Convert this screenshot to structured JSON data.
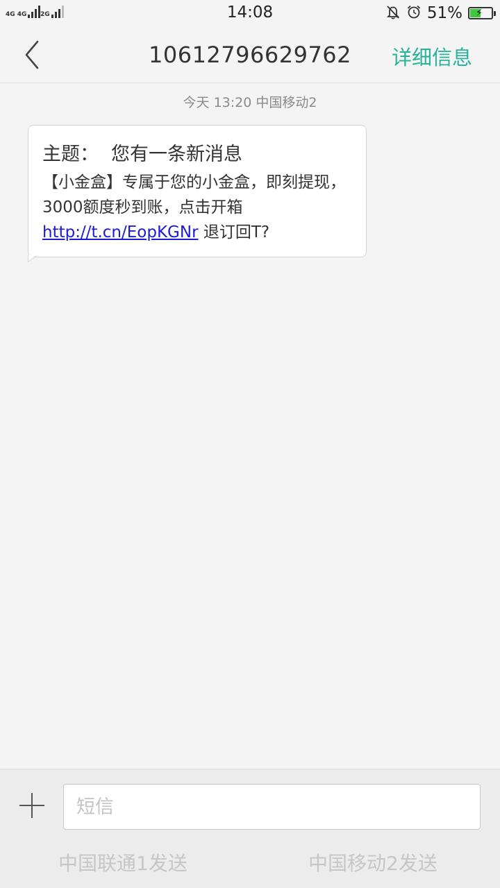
{
  "status_bar": {
    "sim1_label": "4G 4G",
    "sim2_label": "2G",
    "time": "14:08",
    "battery_percent": "51%",
    "battery_level": 0.51
  },
  "header": {
    "title": "10612796629762",
    "action_label": "详细信息"
  },
  "conversation": {
    "timestamp": "今天  13:20  中国移动2",
    "message": {
      "subject_label": "主题：",
      "subject_text": "您有一条新消息",
      "body_before_link": "【小金盒】专属于您的小金盒，即刻提现，3000额度秒到账，点击开箱 ",
      "link_text": "http://t.cn/EopKGNr",
      "body_after_link": " 退订回T?"
    }
  },
  "composer": {
    "placeholder": "短信",
    "send_sim1_label": "中国联通1发送",
    "send_sim2_label": "中国移动2发送"
  },
  "colors": {
    "accent": "#26b39a",
    "link": "#1a1ad8",
    "background": "#f4f4f4"
  },
  "icons": [
    "signal-icon",
    "mute-bell-icon",
    "alarm-icon",
    "battery-charging-icon",
    "back-chevron-icon",
    "plus-icon"
  ]
}
